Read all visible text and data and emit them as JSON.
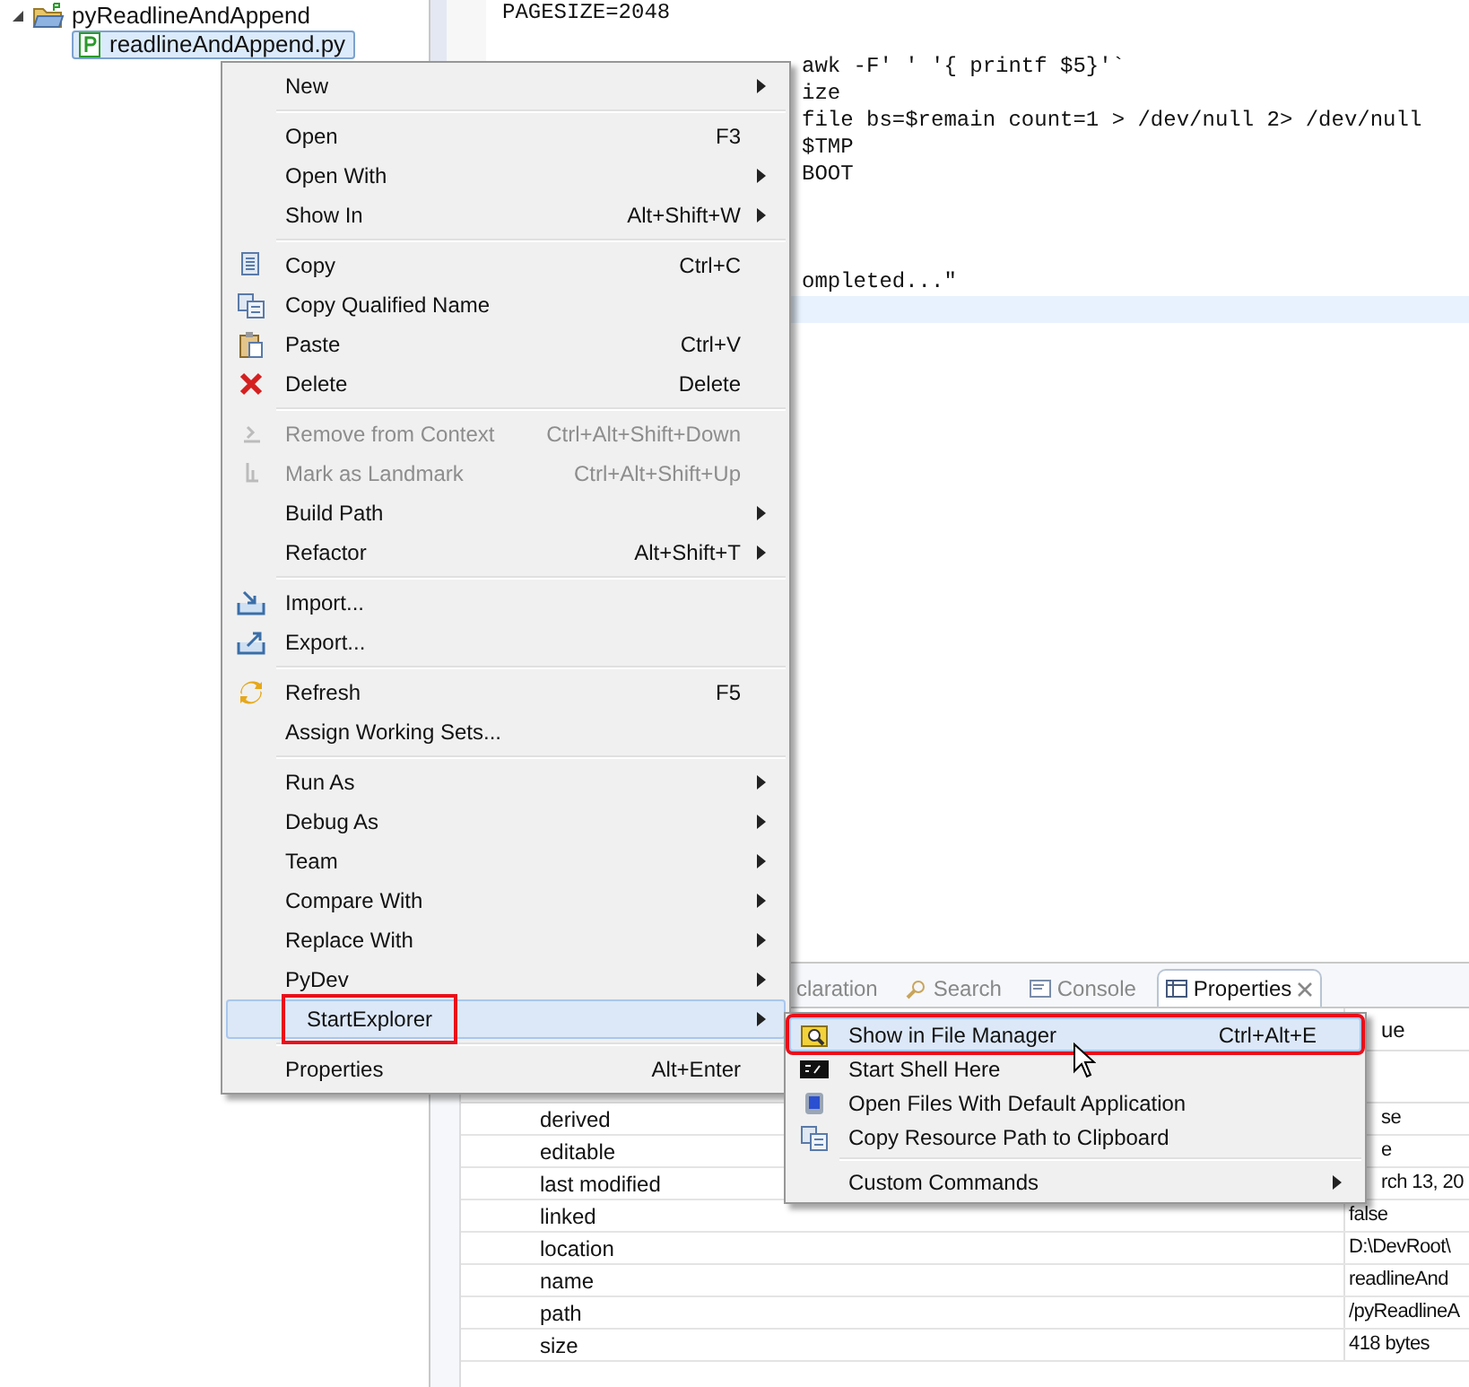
{
  "tree": {
    "project": {
      "label": "pyReadlineAndAppend",
      "expanded": true
    },
    "files": [
      {
        "label": "readlineAndAppend.py",
        "selected": true
      }
    ]
  },
  "editor": {
    "lines": [
      {
        "text": "PAGESIZE=2048",
        "kind": "full"
      },
      {
        "text": "awk -F' ' '{ printf $5}'`",
        "kind": "clipped"
      },
      {
        "text": "ize",
        "kind": "clipped"
      },
      {
        "text": "file bs=$remain count=1 > /dev/null 2> /dev/null",
        "kind": "clipped"
      },
      {
        "text": "$TMP",
        "kind": "clipped"
      },
      {
        "text": "BOOT",
        "kind": "clipped"
      },
      {
        "text": "ompleted...\"",
        "kind": "clipped"
      }
    ]
  },
  "bottom_panel": {
    "tabs": [
      {
        "label": "claration",
        "selected": false
      },
      {
        "label": "Search",
        "selected": false
      },
      {
        "label": "Console",
        "selected": false
      },
      {
        "label": "Properties",
        "selected": true
      }
    ],
    "table": {
      "columns": [
        "ue"
      ],
      "rows": [
        {
          "property": "derived",
          "value": "se"
        },
        {
          "property": "editable",
          "value": "e"
        },
        {
          "property": "last modified",
          "value": "rch 13, 20"
        },
        {
          "property": "linked",
          "value": "false"
        },
        {
          "property": "location",
          "value": "D:\\DevRoot\\"
        },
        {
          "property": "name",
          "value": "readlineAnd"
        },
        {
          "property": "path",
          "value": "/pyReadlineA"
        },
        {
          "property": "size",
          "value": "418  bytes"
        }
      ]
    }
  },
  "context_menu": {
    "groups": [
      [
        {
          "label": "New",
          "submenu": true,
          "disabled": false,
          "selected": false,
          "callout": false
        }
      ],
      [
        {
          "label": "Open",
          "shortcut": "F3",
          "submenu": false,
          "disabled": false,
          "selected": false,
          "callout": false
        },
        {
          "label": "Open With",
          "submenu": true,
          "disabled": false,
          "selected": false,
          "callout": false
        },
        {
          "label": "Show In",
          "shortcut": "Alt+Shift+W",
          "submenu": true,
          "disabled": false,
          "selected": false,
          "callout": false
        }
      ],
      [
        {
          "label": "Copy",
          "shortcut": "Ctrl+C",
          "submenu": false,
          "disabled": false,
          "selected": false,
          "callout": false
        },
        {
          "label": "Copy Qualified Name",
          "submenu": false,
          "disabled": false,
          "selected": false,
          "callout": false
        },
        {
          "label": "Paste",
          "shortcut": "Ctrl+V",
          "submenu": false,
          "disabled": false,
          "selected": false,
          "callout": false
        },
        {
          "label": "Delete",
          "shortcut": "Delete",
          "submenu": false,
          "disabled": false,
          "selected": false,
          "callout": false
        }
      ],
      [
        {
          "label": "Remove from Context",
          "shortcut": "Ctrl+Alt+Shift+Down",
          "submenu": false,
          "disabled": true,
          "selected": false,
          "callout": false
        },
        {
          "label": "Mark as Landmark",
          "shortcut": "Ctrl+Alt+Shift+Up",
          "submenu": false,
          "disabled": true,
          "selected": false,
          "callout": false
        },
        {
          "label": "Build Path",
          "submenu": true,
          "disabled": false,
          "selected": false,
          "callout": false
        },
        {
          "label": "Refactor",
          "shortcut": "Alt+Shift+T",
          "submenu": true,
          "disabled": false,
          "selected": false,
          "callout": false
        }
      ],
      [
        {
          "label": "Import...",
          "submenu": false,
          "disabled": false,
          "selected": false,
          "callout": false
        },
        {
          "label": "Export...",
          "submenu": false,
          "disabled": false,
          "selected": false,
          "callout": false
        }
      ],
      [
        {
          "label": "Refresh",
          "shortcut": "F5",
          "submenu": false,
          "disabled": false,
          "selected": false,
          "callout": false
        },
        {
          "label": "Assign Working Sets...",
          "submenu": false,
          "disabled": false,
          "selected": false,
          "callout": false
        }
      ],
      [
        {
          "label": "Run As",
          "submenu": true,
          "disabled": false,
          "selected": false,
          "callout": false
        },
        {
          "label": "Debug As",
          "submenu": true,
          "disabled": false,
          "selected": false,
          "callout": false
        },
        {
          "label": "Team",
          "submenu": true,
          "disabled": false,
          "selected": false,
          "callout": false
        },
        {
          "label": "Compare With",
          "submenu": true,
          "disabled": false,
          "selected": false,
          "callout": false
        },
        {
          "label": "Replace With",
          "submenu": true,
          "disabled": false,
          "selected": false,
          "callout": false
        },
        {
          "label": "PyDev",
          "submenu": true,
          "disabled": false,
          "selected": false,
          "callout": false
        },
        {
          "label": "StartExplorer",
          "submenu": true,
          "disabled": false,
          "selected": true,
          "callout": true
        }
      ],
      [
        {
          "label": "Properties",
          "shortcut": "Alt+Enter",
          "submenu": false,
          "disabled": false,
          "selected": false,
          "callout": false
        }
      ]
    ]
  },
  "submenu": {
    "groups": [
      [
        {
          "label": "Show in File Manager",
          "shortcut": "Ctrl+Alt+E",
          "submenu": false,
          "selected": true,
          "callout": true
        },
        {
          "label": "Start Shell Here",
          "submenu": false,
          "selected": false,
          "callout": false
        },
        {
          "label": "Open Files With Default Application",
          "submenu": false,
          "selected": false,
          "callout": false
        },
        {
          "label": "Copy Resource Path to Clipboard",
          "submenu": false,
          "selected": false,
          "callout": false
        }
      ],
      [
        {
          "label": "Custom Commands",
          "submenu": true,
          "selected": false,
          "callout": false
        }
      ]
    ]
  }
}
